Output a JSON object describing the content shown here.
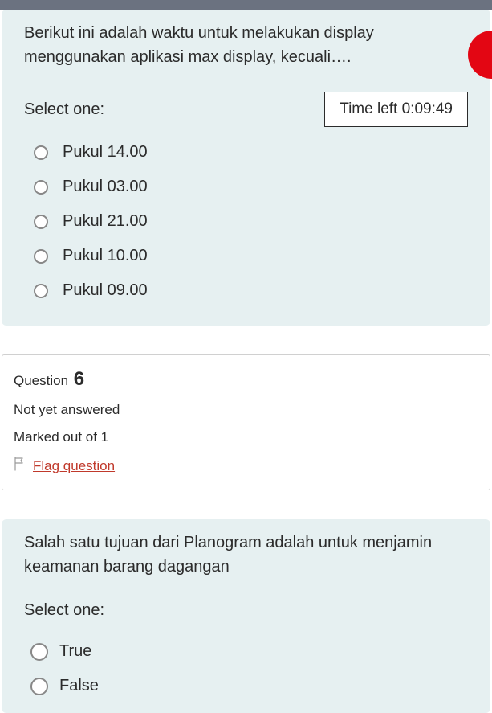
{
  "timer": {
    "text": "Time left 0:09:49"
  },
  "q5": {
    "text": "Berikut ini adalah waktu untuk melakukan display menggunakan aplikasi max display, kecuali….",
    "select_label": "Select one:",
    "options": [
      {
        "label": "Pukul 14.00"
      },
      {
        "label": "Pukul 03.00"
      },
      {
        "label": "Pukul 21.00"
      },
      {
        "label": "Pukul 10.00"
      },
      {
        "label": "Pukul 09.00"
      }
    ]
  },
  "q6meta": {
    "prefix": "Question",
    "number": "6",
    "status": "Not yet answered",
    "marks": "Marked out of 1",
    "flag": "Flag question"
  },
  "q6": {
    "text": "Salah satu tujuan dari Planogram adalah untuk menjamin keamanan barang dagangan",
    "select_label": "Select one:",
    "true_label": "True",
    "false_label": "False"
  }
}
